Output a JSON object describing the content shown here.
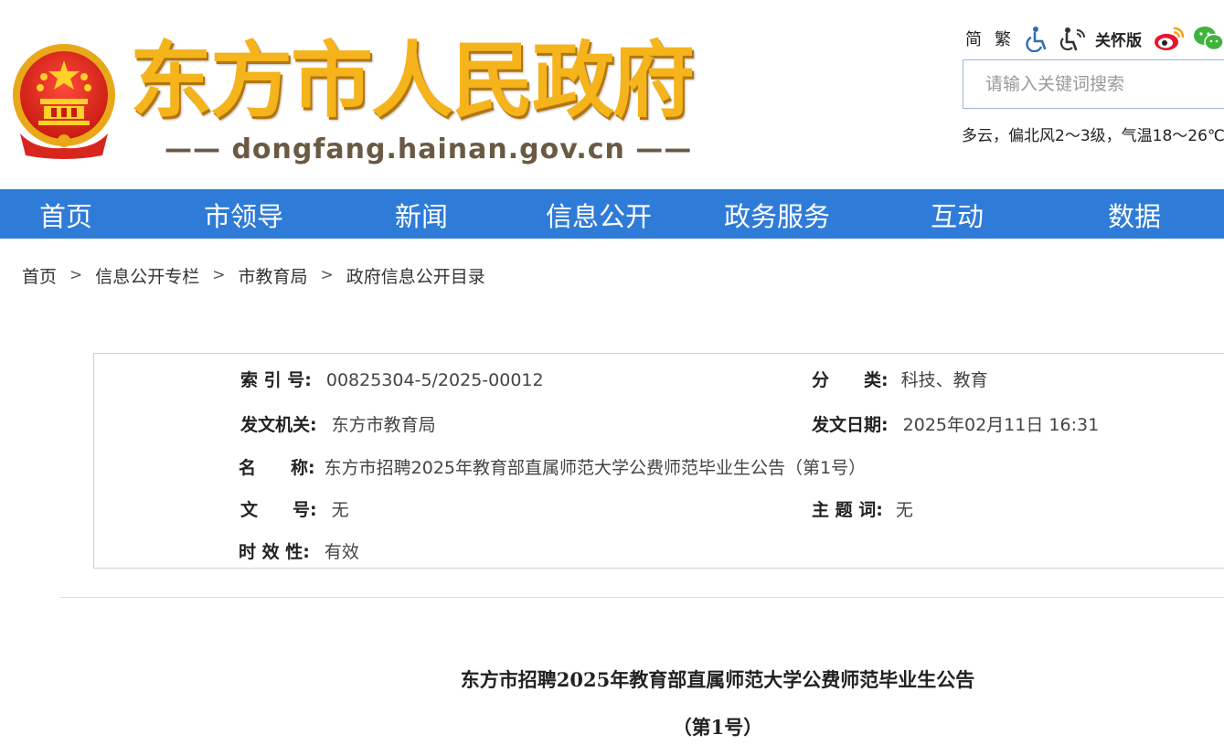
{
  "header": {
    "site_title": "东方市人民政府",
    "site_domain": "—— dongfang.hainan.gov.cn ——",
    "emblem": "national-emblem",
    "tools": {
      "simplified": "简",
      "traditional": "繁",
      "accessibility_icon": "wheelchair-icon",
      "care_icon": "elderly-care-icon",
      "care_label": "关怀版",
      "weibo_icon": "weibo-icon",
      "wechat_icon": "wechat-icon"
    },
    "search": {
      "placeholder": "请输入关键词搜索"
    },
    "weather": "多云，偏北风2～3级，气温18～26℃"
  },
  "nav": {
    "items": [
      {
        "label": "首页"
      },
      {
        "label": "市领导"
      },
      {
        "label": "新闻"
      },
      {
        "label": "信息公开"
      },
      {
        "label": "政务服务"
      },
      {
        "label": "互动"
      },
      {
        "label": "数据"
      }
    ]
  },
  "breadcrumb": {
    "items": [
      "首页",
      "信息公开专栏",
      "市教育局",
      "政府信息公开目录"
    ],
    "separator": ">"
  },
  "meta": {
    "index_label": "索 引 号:",
    "index_value": "00825304-5/2025-00012",
    "category_label": "分　　类:",
    "category_value": "科技、教育",
    "issuer_label": "发文机关:",
    "issuer_value": "东方市教育局",
    "date_label": "发文日期:",
    "date_value": "2025年02月11日 16:31",
    "name_label": "名　　称:",
    "name_value": "东方市招聘2025年教育部直属师范大学公费师范毕业生公告（第1号）",
    "doc_no_label": "文　　号:",
    "doc_no_value": "无",
    "keyword_label": "主 题 词:",
    "keyword_value": "无",
    "validity_label": "时 效 性:",
    "validity_value": "有效"
  },
  "article": {
    "title": "东方市招聘2025年教育部直属师范大学公费师范毕业生公告",
    "subtitle": "（第1号）"
  },
  "colors": {
    "nav_bg": "#2f7bd8",
    "title_gold": "#f5b41c",
    "emblem_red": "#d7261e"
  }
}
